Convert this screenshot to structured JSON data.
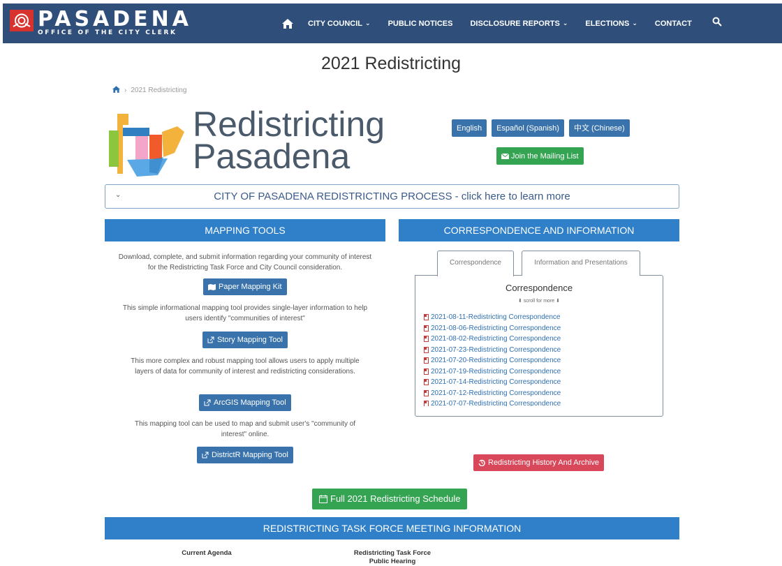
{
  "nav": {
    "logo_title": "PASADENA",
    "logo_subtitle": "OFFICE OF THE CITY CLERK",
    "items": [
      {
        "label": "CITY COUNCIL",
        "dropdown": true
      },
      {
        "label": "PUBLIC NOTICES",
        "dropdown": false
      },
      {
        "label": "DISCLOSURE REPORTS",
        "dropdown": true
      },
      {
        "label": "ELECTIONS",
        "dropdown": true
      },
      {
        "label": "CONTACT",
        "dropdown": false
      }
    ],
    "home_icon": "home-icon",
    "search_icon": "search-icon"
  },
  "page": {
    "title": "2021 Redistricting",
    "breadcrumb": "2021 Redistricting"
  },
  "brand": {
    "line1": "Redistricting",
    "line2": "Pasadena"
  },
  "language_buttons": [
    "English",
    "Español (Spanish)",
    "中文 (Chinese)"
  ],
  "join_button": "Join the Mailing List",
  "accordion_label": "CITY OF PASADENA REDISTRICTING PROCESS - click here to learn more",
  "mapping": {
    "heading": "MAPPING TOOLS",
    "intro": "Download, complete, and submit information regarding your community of interest for the Redistricting Task Force and City Council consideration.",
    "paper_kit": "Paper Mapping Kit",
    "story_text": "This simple informational mapping tool provides single-layer information to help users identify \"communities of interest\"",
    "story_btn": "Story Mapping Tool",
    "arcgis_text": "This more complex and robust mapping tool allows users to apply multiple layers of data for community of interest and redistricting considerations.",
    "arcgis_btn": "ArcGIS Mapping Tool",
    "districtr_text": "This mapping tool can be used to map and submit user's \"community of interest\" online.",
    "districtr_btn": "DistrictR Mapping Tool"
  },
  "correspondence": {
    "heading": "CORRESPONDENCE AND INFORMATION",
    "tabs": [
      "Correspondence",
      "Information and Presentations"
    ],
    "panel_title": "Correspondence",
    "scroll_hint": "scroll for more",
    "items": [
      "2021-08-11-Redistricting Correspondence",
      "2021-08-06-Redistricting Correspondence",
      "2021-08-02-Redistricting Correspondence",
      "2021-07-23-Redistricting Correspondence",
      "2021-07-20-Redistricting Correspondence",
      "2021-07-19-Redistricting Correspondence",
      "2021-07-14-Redistricting Correspondence",
      "2021-07-12-Redistricting Correspondence",
      "2021-07-07-Redistricting Correspondence"
    ]
  },
  "history_button": "Redistricting History And Archive",
  "schedule_button": "Full 2021 Redistricting Schedule",
  "meeting": {
    "heading": "REDISTRICTING TASK FORCE MEETING INFORMATION",
    "current_agenda": "Current Agenda",
    "hearing_line1": "Redistricting Task Force",
    "hearing_line2": "Public Hearing"
  },
  "colors": {
    "nav_bg": "#2f4f7a",
    "section_blue": "#2f80c8",
    "button_blue": "#3a73ac",
    "button_green": "#34a452",
    "button_red": "#d9485a",
    "link_blue": "#2f6fb0"
  }
}
